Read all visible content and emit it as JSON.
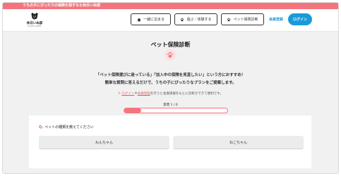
{
  "banner": {
    "text": "うちの子にぴったりの保険を探すなら休日いぬ部"
  },
  "header": {
    "logo_name": "休日いぬ部",
    "logo_sub": "HOLIDAY INUBU",
    "nav": [
      {
        "label": "一緒に泊まる",
        "icon": "house-icon"
      },
      {
        "label": "遊ぶ・体験する",
        "icon": "paw-icon"
      },
      {
        "label": "ペット保険診断",
        "icon": "paw-icon"
      }
    ],
    "register_label": "会員登録",
    "login_label": "ログイン"
  },
  "main": {
    "title": "ペット保険診断",
    "intro_line1": "「ペット保険選びに迷っている」「加入中の保険を見直したい」という方におすすめ！",
    "intro_line2": "簡単な質問に答えるだけで、うちの子にぴったりなプランをご提案します。",
    "note_prefix": "※",
    "note_login": "ログイン",
    "note_or": "や",
    "note_register": "会員登録",
    "note_suffix": "を行うと会員情報をもとに診断ができて便利です。",
    "question_counter": "質問 1 / 6",
    "progress_fraction": 0.1667
  },
  "question": {
    "marker": "Q.",
    "text": "ペットの種類を教えてください",
    "options": [
      "わんちゃん",
      "ねこちゃん"
    ]
  },
  "colors": {
    "accent": "#f4747e",
    "link_blue": "#1a9bd8"
  }
}
